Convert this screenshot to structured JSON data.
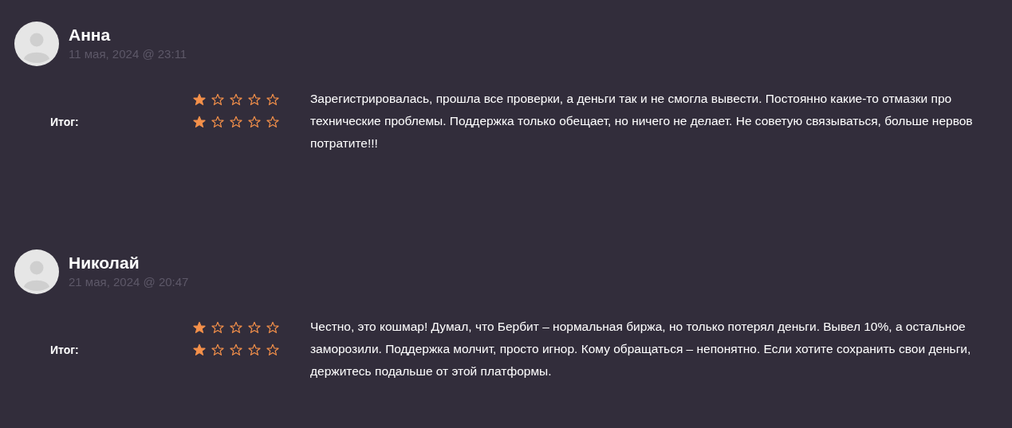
{
  "reviews": [
    {
      "name": "Анна",
      "date": "11 мая, 2024 @ 23:11",
      "ratings": [
        {
          "stars": 1
        },
        {
          "label": "Итог:",
          "stars": 1
        }
      ],
      "text": "Зарегистрировалась, прошла все проверки, а деньги так и не смогла вывести. Постоянно какие-то отмазки про технические проблемы. Поддержка только обещает, но ничего не делает. Не советую связываться, больше нервов потратите!!!"
    },
    {
      "name": "Николай",
      "date": "21 мая, 2024 @ 20:47",
      "ratings": [
        {
          "stars": 1
        },
        {
          "label": "Итог:",
          "stars": 1
        }
      ],
      "text": "Честно, это кошмар! Думал, что Бербит – нормальная биржа, но только потерял деньги. Вывел 10%, а остальное заморозили. Поддержка молчит, просто игнор. Кому обращаться – непонятно. Если хотите сохранить свои деньги, держитесь подальше от этой платформы."
    }
  ]
}
